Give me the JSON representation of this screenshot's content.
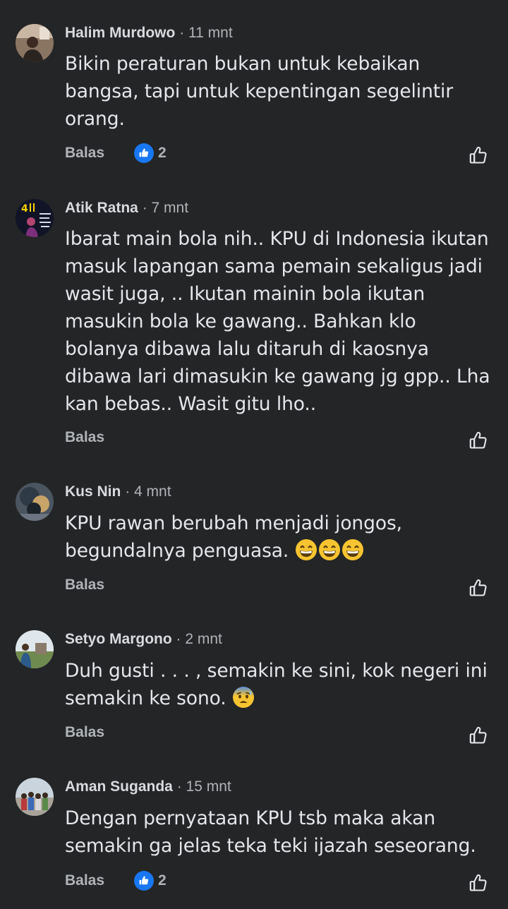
{
  "comments": [
    {
      "author": "Halim Murdowo",
      "time": "11 mnt",
      "text": "Bikin peraturan bukan untuk kebaikan bangsa, tapi untuk kepentingan segelintir orang.",
      "reply_label": "Balas",
      "reaction_count": "2",
      "reaction_icon": "like-badge-icon"
    },
    {
      "author": "Atik Ratna",
      "time": "7 mnt",
      "text": "Ibarat main bola nih.. KPU di Indonesia ikutan masuk lapangan sama pemain sekaligus jadi wasit juga, .. Ikutan mainin bola ikutan masukin bola ke gawang.. Bahkan klo bolanya dibawa lalu ditaruh di kaosnya dibawa lari dimasukin ke gawang jg gpp.. Lha kan bebas.. Wasit gitu lho..",
      "reply_label": "Balas"
    },
    {
      "author": "Kus Nin",
      "time": "4 mnt",
      "text": "KPU rawan berubah menjadi jongos, begundalnya penguasa.",
      "emoji": [
        "grinning-face-emoji",
        "grinning-face-emoji",
        "grinning-face-emoji"
      ],
      "reply_label": "Balas"
    },
    {
      "author": "Setyo Margono",
      "time": "2 mnt",
      "text": "Duh gusti . . . , semakin ke sini, kok negeri ini semakin ke sono.",
      "emoji": [
        "anxious-face-emoji"
      ],
      "reply_label": "Balas"
    },
    {
      "author": "Aman Suganda",
      "time": "15 mnt",
      "text": "Dengan pernyataan KPU tsb maka akan semakin ga jelas teka teki ijazah seseorang.",
      "reply_label": "Balas",
      "reaction_count": "2",
      "reaction_icon": "like-badge-icon"
    }
  ],
  "separator": "·",
  "colors": {
    "background": "#242526",
    "text": "#e4e6eb",
    "secondary_text": "#b0b3b8",
    "like_blue": "#1877f2"
  }
}
